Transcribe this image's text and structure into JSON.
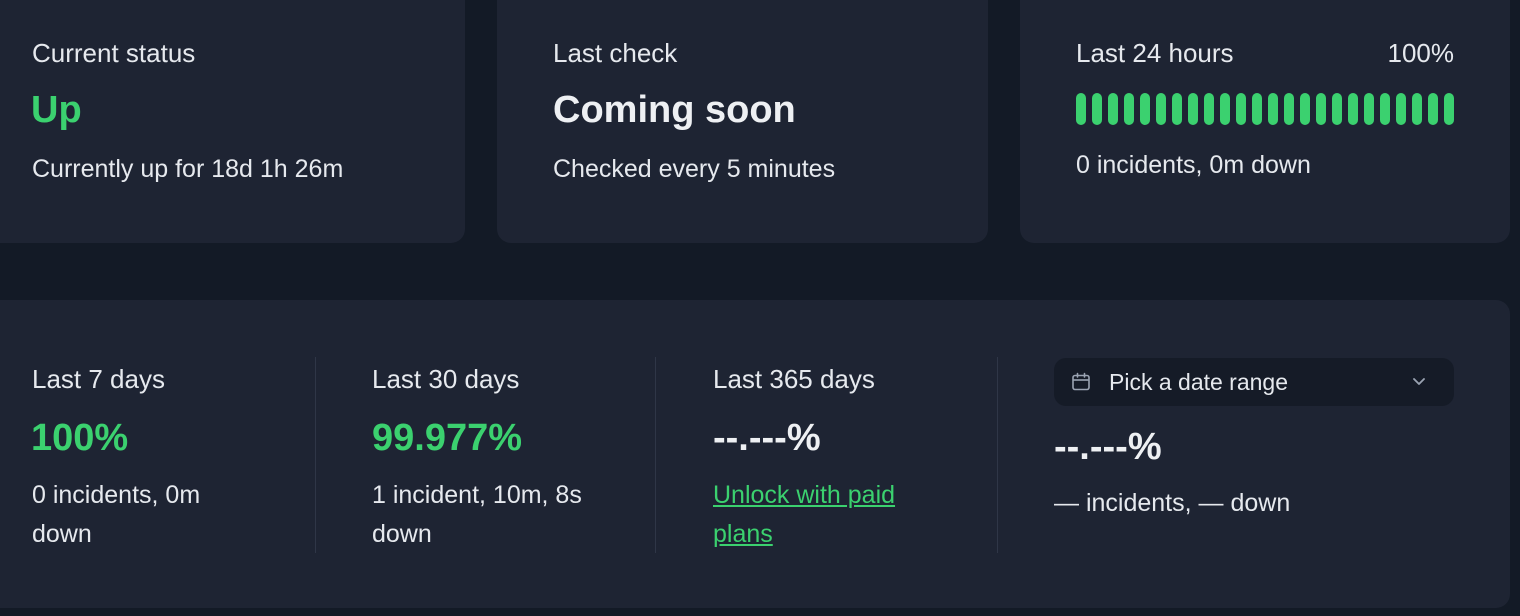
{
  "current_status": {
    "label": "Current status",
    "value": "Up",
    "detail": "Currently up for 18d 1h 26m"
  },
  "last_check": {
    "label": "Last check",
    "value": "Coming soon",
    "detail": "Checked every 5 minutes"
  },
  "last_24h": {
    "label": "Last 24 hours",
    "percent": "100%",
    "bar_count": 24,
    "bar_status": "all up",
    "detail": "0 incidents, 0m down"
  },
  "ranges": {
    "days7": {
      "label": "Last 7 days",
      "value": "100%",
      "detail_line1": "0 incidents, 0m",
      "detail_line2": "down"
    },
    "days30": {
      "label": "Last 30 days",
      "value": "99.977%",
      "detail_line1": "1 incident, 10m, 8s",
      "detail_line2": "down"
    },
    "days365": {
      "label": "Last 365 days",
      "value": "--.---%",
      "link_line1": "Unlock with paid",
      "link_line2": "plans"
    },
    "custom": {
      "picker_label": "Pick a date range",
      "value": "--.---%",
      "detail": "— incidents, — down"
    }
  },
  "colors": {
    "accent_green": "#3bd16f",
    "card_bg": "#1e2433",
    "page_bg": "#131a26"
  },
  "icons": {
    "calendar": "calendar-icon",
    "chevron": "chevron-down-icon"
  }
}
